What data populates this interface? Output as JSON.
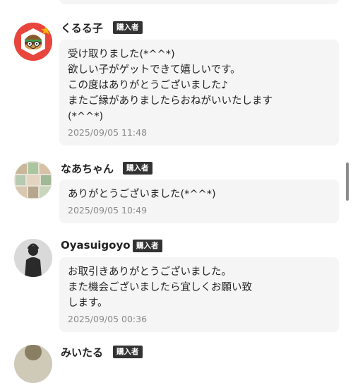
{
  "comments": [
    {
      "username": "くるる子",
      "badge": "購入者",
      "avatar": "burger-character-avatar",
      "message": "受け取りました(*^^*)\n欲しい子がゲットできて嬉しいです。\nこの度はありがとうございました♪\nまたご縁がありましたらおねがいいたします\n(*^^*)",
      "timestamp": "2025/09/05 11:48"
    },
    {
      "username": "なあちゃん",
      "badge": "購入者",
      "avatar": "collage-photo-avatar",
      "message": "ありがとうございました(*^^*)",
      "timestamp": "2025/09/05 10:49"
    },
    {
      "username": "Oyasuigoyo",
      "badge": "購入者",
      "avatar": "person-silhouette-avatar",
      "message": "お取引きありがとうございました。\nまた機会ございましたら宜しくお願い致\nします。",
      "timestamp": "2025/09/05 00:36"
    },
    {
      "username": "みいたる",
      "badge": "購入者",
      "avatar": "partial-avatar"
    }
  ],
  "colors": {
    "bubble": "#f5f5f5",
    "badge": "#333333",
    "timestamp": "#8a8a8a"
  }
}
